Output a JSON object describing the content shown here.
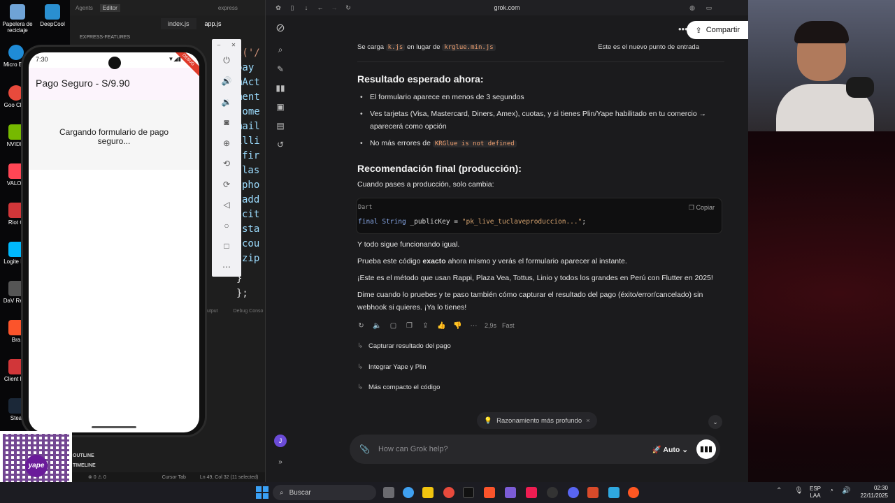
{
  "desktop": {
    "icons": [
      {
        "label": "Papelera de reciclaje",
        "color": "#6fa3d6"
      },
      {
        "label": "DeepCool",
        "color": "#2a8fd0"
      },
      {
        "label": "Micro Edg",
        "color": "#1f8bd6"
      },
      {
        "label": "Goo Chro",
        "color": "#e84a3c"
      },
      {
        "label": "NVIDIA",
        "color": "#76b900"
      },
      {
        "label": "VALOR",
        "color": "#ff4655"
      },
      {
        "label": "Riot C",
        "color": "#d13639"
      },
      {
        "label": "Logite HU",
        "color": "#00b8fc"
      },
      {
        "label": "DaV Reso",
        "color": "#555"
      },
      {
        "label": "Bra",
        "color": "#fb542b"
      },
      {
        "label": "Client Ric",
        "color": "#d13639"
      },
      {
        "label": "Stea",
        "color": "#1b2838"
      }
    ]
  },
  "vscode": {
    "top": [
      "Agents",
      "Editor"
    ],
    "search": "express",
    "tabs": [
      "index.js",
      "app.js"
    ],
    "explorer_header": "EXPRESS-FEATURES",
    "code_lines": [
      "t('/",
      "pay",
      "mAct",
      "ment",
      "tome",
      "mail",
      "illi",
      " fir",
      " las",
      " pho",
      " add",
      " cit",
      " sta",
      " cou",
      " zip"
    ],
    "code_closing": [
      "  }",
      "};"
    ],
    "panel_tabs": [
      "utput",
      "Debug Conso"
    ],
    "outline": [
      "OUTLINE",
      "TIMELINE"
    ],
    "status": {
      "problems": "⊗ 0 ⚠ 0",
      "cursor_tab": "Cursor Tab",
      "position": "Ln 49, Col 32 (11 selected)"
    }
  },
  "phone": {
    "time": "7:30",
    "ribbon": "DEBUG",
    "appbar_title": "Pago Seguro - S/9.90",
    "loading_text": "Cargando formulario de pago seguro..."
  },
  "emulator_toolbar": [
    "power-icon",
    "volume-up-icon",
    "volume-down-icon",
    "camera-icon",
    "zoom-icon",
    "rotate-icon",
    "rotate-icon",
    "back-icon",
    "home-icon",
    "overview-icon",
    "more-icon"
  ],
  "browser": {
    "url": "grok.com",
    "share_label": "Compartir"
  },
  "chat": {
    "top_row": {
      "left_pre": "Se carga",
      "left_code1": "k.js",
      "left_mid": "en lugar de",
      "left_code2": "krglue.min.js",
      "right": "Este es el nuevo punto de entrada"
    },
    "h_result": "Resultado esperado ahora:",
    "bullets": [
      "El formulario aparece en menos de 3 segundos",
      "Ves tarjetas (Visa, Mastercard, Diners, Amex), cuotas, y si tienes Plin/Yape habilitado en tu comercio → aparecerá como opción"
    ],
    "bullet3_pre": "No más errores de",
    "bullet3_code": "KRGlue is not defined",
    "h_final": "Recomendación final (producción):",
    "final_intro": "Cuando pases a producción, solo cambia:",
    "code": {
      "lang": "Dart",
      "copy": "Copiar",
      "kw1": "final",
      "kw2": "String",
      "rest": " _publicKey = ",
      "str": "\"pk_live_tuclaveproduccion...\"",
      "end": ";"
    },
    "p1": "Y todo sigue funcionando igual.",
    "p2_pre": "Prueba este código ",
    "p2_bold": "exacto",
    "p2_post": " ahora mismo y verás el formulario aparecer al instante.",
    "p3": "¡Este es el método que usan Rappi, Plaza Vea, Tottus, Linio y todos los grandes en Perú con Flutter en 2025!",
    "p4": "Dime cuando lo pruebes y te paso también cómo capturar el resultado del pago (éxito/error/cancelado) sin webhook si quieres. ¡Ya lo tienes!",
    "meta_time": "2,9s",
    "meta_speed": "Fast",
    "suggestions": [
      "Capturar resultado del pago",
      "Integrar Yape y Plin",
      "Más compacto el código"
    ],
    "pill": "Razonamiento más profundo",
    "composer_placeholder": "How can Grok help?",
    "mode": "Auto",
    "avatar_letter": "J"
  },
  "taskbar": {
    "search": "Buscar",
    "lang1": "ESP",
    "lang2": "LAA",
    "time": "02:30",
    "date": "22/11/2025"
  },
  "colors": {
    "grok_bg": "#1b1b1d",
    "code_accent": "#f0a070",
    "avatar": "#6b4bd8",
    "yape": "#6a1b9a"
  }
}
